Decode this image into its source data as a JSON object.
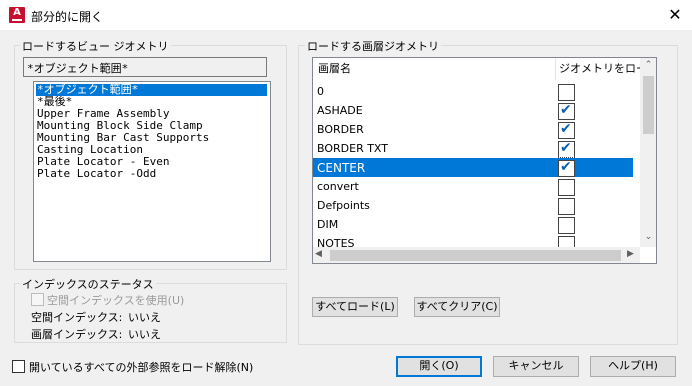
{
  "window": {
    "title": "部分的に開く",
    "app_icon_letter": "A",
    "close_glyph": "✕"
  },
  "view_group": {
    "label": "ロードするビュー ジオメトリ",
    "current_value": "*オブジェクト範囲*",
    "items": [
      {
        "label": "*オブジェクト範囲*",
        "selected": true
      },
      {
        "label": "*最後*",
        "selected": false
      },
      {
        "label": "Upper Frame Assembly",
        "selected": false
      },
      {
        "label": "Mounting Block Side Clamp",
        "selected": false
      },
      {
        "label": "Mounting Bar Cast Supports",
        "selected": false
      },
      {
        "label": "Casting Location",
        "selected": false
      },
      {
        "label": "Plate Locator - Even",
        "selected": false
      },
      {
        "label": "Plate Locator -Odd",
        "selected": false
      }
    ]
  },
  "index_group": {
    "label": "インデックスのステータス",
    "use_spatial_index_label": "空間インデックスを使用(U)",
    "spatial_index_label": "空間インデックス:",
    "spatial_index_value": "いいえ",
    "layer_index_label": "画層インデックス:",
    "layer_index_value": "いいえ"
  },
  "layer_group": {
    "label": "ロードする画層ジオメトリ",
    "col_name": "画層名",
    "col_load": "ジオメトリをロード",
    "rows": [
      {
        "name": "0",
        "checked": false,
        "selected": false
      },
      {
        "name": "ASHADE",
        "checked": true,
        "selected": false
      },
      {
        "name": "BORDER",
        "checked": true,
        "selected": false
      },
      {
        "name": "BORDER TXT",
        "checked": true,
        "selected": false
      },
      {
        "name": "CENTER",
        "checked": true,
        "selected": true
      },
      {
        "name": "convert",
        "checked": false,
        "selected": false
      },
      {
        "name": "Defpoints",
        "checked": false,
        "selected": false
      },
      {
        "name": "DIM",
        "checked": false,
        "selected": false
      },
      {
        "name": "NOTES",
        "checked": false,
        "selected": false
      }
    ],
    "load_all_label": "すべてロード(L)",
    "clear_all_label": "すべてクリア(C)"
  },
  "footer": {
    "unload_xrefs_label": "開いているすべての外部参照をロード解除(N)",
    "open_label": "開く(O)",
    "cancel_label": "キャンセル",
    "help_label": "ヘルプ(H)"
  },
  "colors": {
    "selection": "#0078d7",
    "check": "#0a5fb4",
    "app_icon": "#c8102e"
  }
}
